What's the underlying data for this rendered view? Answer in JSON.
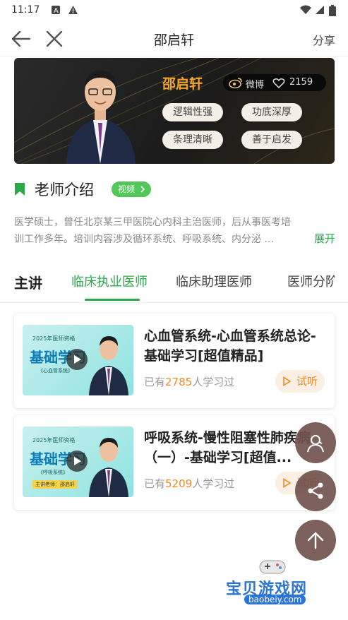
{
  "status_bar": {
    "time": "11:17",
    "icons": [
      "A-notification-icon",
      "warning-icon",
      "wifi-icon",
      "signal-icon",
      "battery-icon"
    ]
  },
  "header": {
    "title": "邵启轩",
    "share_label": "分享"
  },
  "banner": {
    "teacher_name": "邵启轩",
    "weibo_label": "微博",
    "likes": "2159",
    "tags": [
      "逻辑性强",
      "功底深厚",
      "条理清晰",
      "善于启发"
    ]
  },
  "intro": {
    "title": "老师介绍",
    "video_label": "视频",
    "text_line1": "医学硕士，曾任北京某三甲医院心内科主治医师，后从事医考培",
    "text_line2": "训工作多年。培训内容涉及循环系统、呼吸系统、内分泌 ...",
    "expand_label": "展开"
  },
  "tabs": {
    "label": "主讲",
    "items": [
      "临床执业医师",
      "临床助理医师",
      "医师分阶"
    ],
    "active_index": 0
  },
  "courses": [
    {
      "title": "心血管系统-心血管系统总论-基础学习[超值精品]",
      "learners_prefix": "已有",
      "learners_count": "2785",
      "learners_suffix": "人学习过",
      "trial_label": "试听",
      "thumb": {
        "year": "2025年医师资格",
        "main": "基础学习",
        "sub": "《心血管系统》"
      }
    },
    {
      "title": "呼吸系统-慢性阻塞性肺疾病（一）-基础学习[超值...",
      "learners_prefix": "已有",
      "learners_count": "5209",
      "learners_suffix": "人学习过",
      "trial_label": "试听",
      "thumb": {
        "year": "2025年医师资格",
        "main": "基础学习",
        "sub": "《呼吸系统》",
        "teacher_line": "主讲老师：邵启轩"
      }
    }
  ],
  "watermark": {
    "title": "宝贝游戏网",
    "url": "baobeiy.com"
  },
  "colors": {
    "accent_green": "#2aa84a",
    "name_gold": "#f5a623",
    "count_orange": "#f08a24",
    "fab_brown": "#70524d"
  }
}
